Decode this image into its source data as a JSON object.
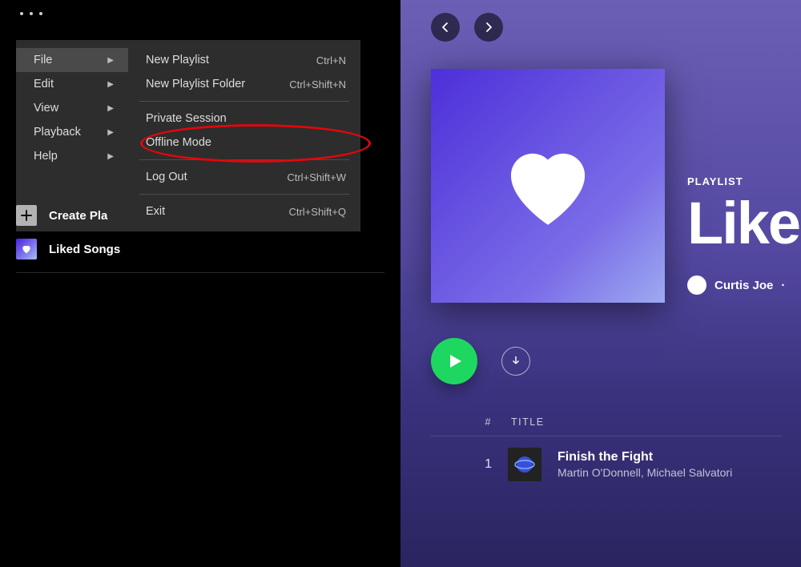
{
  "menu": {
    "col1": [
      {
        "label": "File",
        "selected": true
      },
      {
        "label": "Edit"
      },
      {
        "label": "View"
      },
      {
        "label": "Playback"
      },
      {
        "label": "Help"
      }
    ],
    "col2": [
      {
        "label": "New Playlist",
        "shortcut": "Ctrl+N"
      },
      {
        "label": "New Playlist Folder",
        "shortcut": "Ctrl+Shift+N"
      },
      {
        "sep": true
      },
      {
        "label": "Private Session"
      },
      {
        "label": "Offline Mode"
      },
      {
        "sep": true
      },
      {
        "label": "Log Out",
        "shortcut": "Ctrl+Shift+W"
      },
      {
        "sep": true
      },
      {
        "label": "Exit",
        "shortcut": "Ctrl+Shift+Q"
      }
    ]
  },
  "sidebar": {
    "create": "Create Pla",
    "liked": "Liked Songs"
  },
  "playlist": {
    "label": "PLAYLIST",
    "title": "Like",
    "owner": "Curtis Joe",
    "columns": {
      "num": "#",
      "title": "TITLE"
    },
    "tracks": [
      {
        "num": "1",
        "title": "Finish the Fight",
        "artist": "Martin O'Donnell, Michael Salvatori"
      }
    ]
  }
}
